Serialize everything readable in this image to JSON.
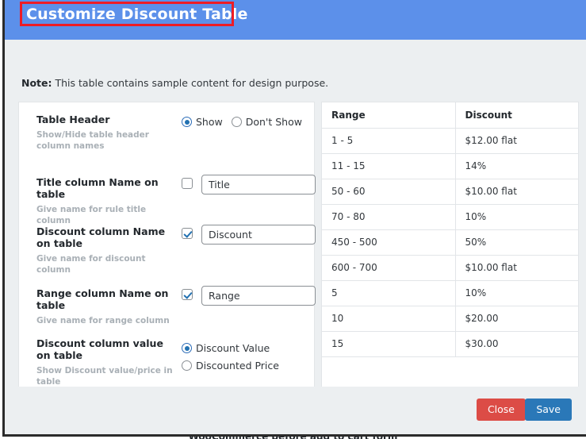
{
  "behind_page": {
    "partial_text": "WooCommerce before add to cart form"
  },
  "modal": {
    "title": "Customize Discount Table",
    "annotation": {
      "name": "red-highlight-box",
      "color": "#ee1c25"
    },
    "header_color": "#5c90ea",
    "note": {
      "prefix": "Note:",
      "text": " This table contains sample content for design purpose."
    },
    "settings": [
      {
        "title": "Table Header",
        "description": "Show/Hide table header column names",
        "control": "radio-inline",
        "options": [
          {
            "label": "Show",
            "checked": true
          },
          {
            "label": "Don't Show",
            "checked": false
          }
        ]
      },
      {
        "title": "Title column Name on table",
        "description": "Give name for rule title column",
        "control": "checkbox-input",
        "checked": false,
        "value": "Title"
      },
      {
        "title": "Discount column Name on table",
        "description": "Give name for discount column",
        "control": "checkbox-input",
        "checked": true,
        "value": "Discount"
      },
      {
        "title": "Range column Name on table",
        "description": "Give name for range column",
        "control": "checkbox-input",
        "checked": true,
        "value": "Range"
      },
      {
        "title": "Discount column value on table",
        "description": "Show Discount value/price in table",
        "control": "radio-stacked",
        "options": [
          {
            "label": "Discount Value",
            "checked": true
          },
          {
            "label": "Discounted Price",
            "checked": false
          }
        ]
      }
    ],
    "preview_table": {
      "columns": [
        "Range",
        "Discount"
      ],
      "rows": [
        [
          "1 - 5",
          "$12.00 flat"
        ],
        [
          "11 - 15",
          "14%"
        ],
        [
          "50 - 60",
          "$10.00 flat"
        ],
        [
          "70 - 80",
          "10%"
        ],
        [
          "450 - 500",
          "50%"
        ],
        [
          "600 - 700",
          "$10.00 flat"
        ],
        [
          "5",
          "10%"
        ],
        [
          "10",
          "$20.00"
        ],
        [
          "15",
          "$30.00"
        ]
      ]
    },
    "footer": {
      "close_label": "Close",
      "close_color": "#dc4c46",
      "save_label": "Save",
      "save_color": "#2a78b8"
    }
  }
}
